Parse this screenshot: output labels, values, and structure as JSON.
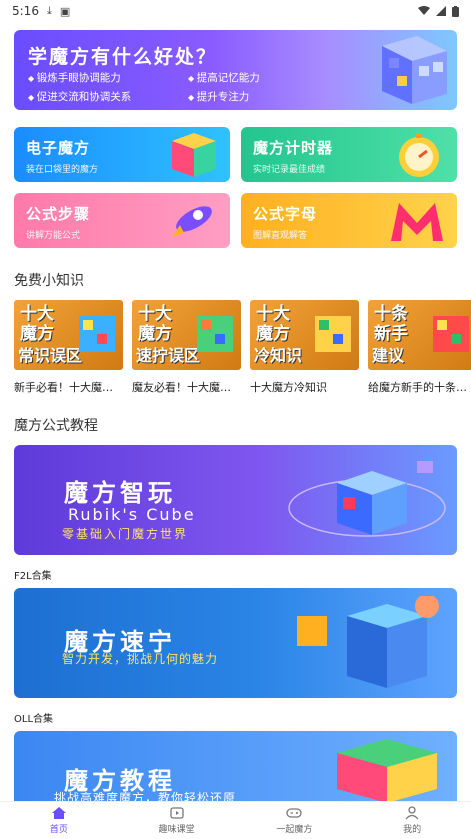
{
  "status_bar": {
    "time": "5:16",
    "left_icons": [
      "download-icon",
      "sim-icon"
    ],
    "right_icons": [
      "wifi-icon",
      "signal-icon",
      "battery-icon"
    ]
  },
  "hero": {
    "title": "学魔方有什么好处？",
    "points": [
      "锻炼手眼协调能力",
      "提高记忆能力",
      "促进交流和协调关系",
      "提升专注力"
    ]
  },
  "cards": [
    {
      "title": "电子魔方",
      "subtitle": "装在口袋里的魔方",
      "icon": "cube-icon"
    },
    {
      "title": "魔方计时器",
      "subtitle": "实时记录最佳成绩",
      "icon": "stopwatch-icon"
    },
    {
      "title": "公式步骤",
      "subtitle": "讲解万能公式",
      "icon": "rocket-icon"
    },
    {
      "title": "公式字母",
      "subtitle": "图解直观解答",
      "icon": "letter-m-icon"
    }
  ],
  "sections": {
    "tips_title": "免费小知识",
    "formula_title": "魔方公式教程"
  },
  "tips": [
    {
      "thumb_top": "十大\n魔方",
      "thumb_bottom": "常识误区",
      "caption": "新手必看！十大魔方常识误区"
    },
    {
      "thumb_top": "十大\n魔方",
      "thumb_bottom": "速拧误区",
      "caption": "魔友必看！十大魔方速拧误区"
    },
    {
      "thumb_top": "十大\n魔方",
      "thumb_bottom": "冷知识",
      "caption": "十大魔方冷知识"
    },
    {
      "thumb_top": "十条\n新手",
      "thumb_bottom": "建议",
      "caption": "给魔方新手的十条建议"
    }
  ],
  "banners": [
    {
      "title": "魔方智玩",
      "en": "Rubik's Cube",
      "subtitle": "零基础入门魔方世界",
      "caption": "F2L合集"
    },
    {
      "title": "魔方速宁",
      "subtitle": "智力开发，挑战几何的魅力",
      "caption": "OLL合集"
    },
    {
      "title": "魔方教程",
      "subtitle": "挑战高难度魔方，教你轻松还原"
    }
  ],
  "tabbar": [
    {
      "label": "首页",
      "icon": "home-icon",
      "active": true
    },
    {
      "label": "趣味课堂",
      "icon": "tv-icon",
      "active": false
    },
    {
      "label": "一起魔方",
      "icon": "gamepad-icon",
      "active": false
    },
    {
      "label": "我的",
      "icon": "user-icon",
      "active": false
    }
  ],
  "colors": {
    "accent": "#6b4dff",
    "text": "#222222",
    "muted": "#666666"
  }
}
